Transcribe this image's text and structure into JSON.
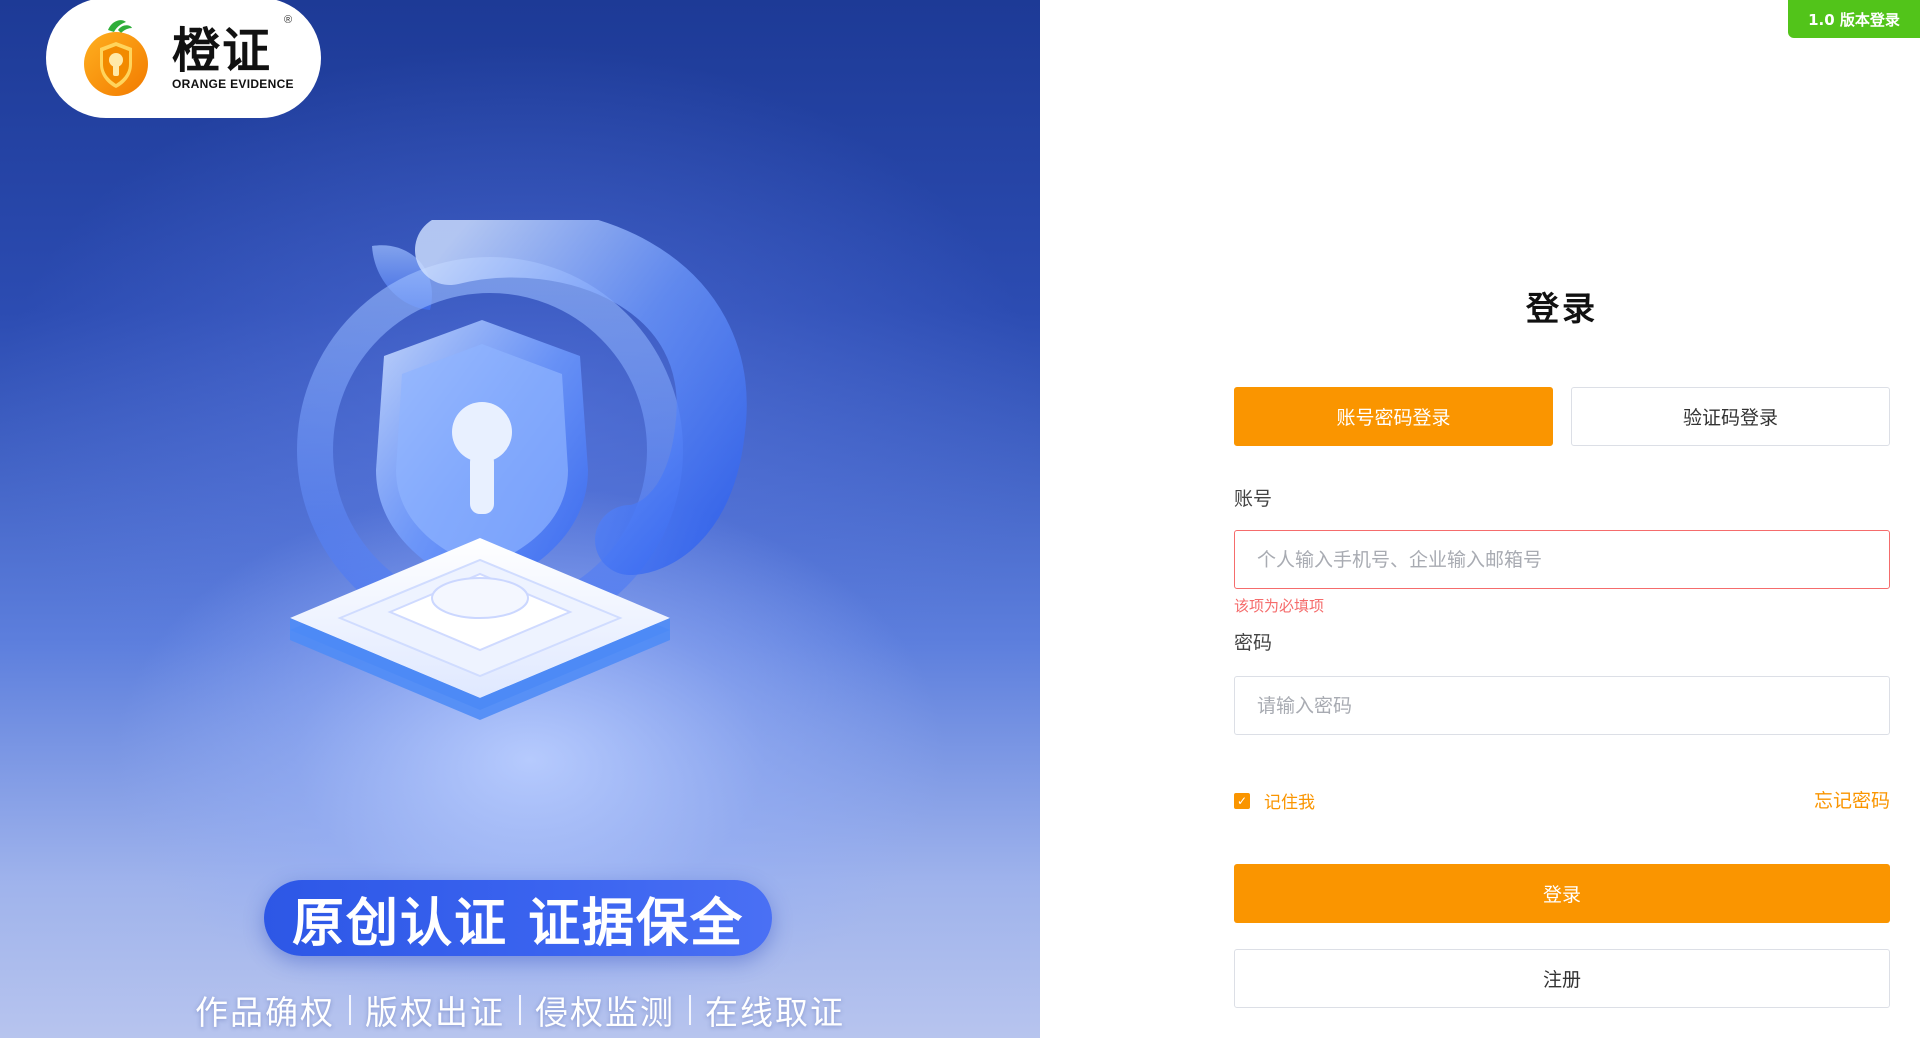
{
  "brand": {
    "name_cn": "橙证",
    "name_en": "ORANGE EVIDENCE",
    "registered_mark": "®",
    "orange_color": "#fa9500"
  },
  "hero": {
    "slogan": "原创认证  证据保全",
    "features": [
      "作品确权",
      "版权出证",
      "侵权监测",
      "在线取证"
    ],
    "illustration": "padlock-shield-3d-icon"
  },
  "version_badge": "1.0 版本登录",
  "login": {
    "title": "登录",
    "tabs": [
      {
        "label": "账号密码登录",
        "active": true
      },
      {
        "label": "验证码登录",
        "active": false
      }
    ],
    "account": {
      "label": "账号",
      "placeholder": "个人输入手机号、企业输入邮箱号",
      "value": "",
      "error": "该项为必填项"
    },
    "password": {
      "label": "密码",
      "placeholder": "请输入密码",
      "value": ""
    },
    "remember_me": {
      "label": "记住我",
      "checked": true
    },
    "forgot_password": "忘记密码",
    "submit_label": "登录",
    "register_label": "注册"
  },
  "colors": {
    "accent": "#fa9500",
    "badge_green": "#52c41a",
    "error_red": "#f56c6c",
    "hero_blue": "#2c4cb2"
  }
}
